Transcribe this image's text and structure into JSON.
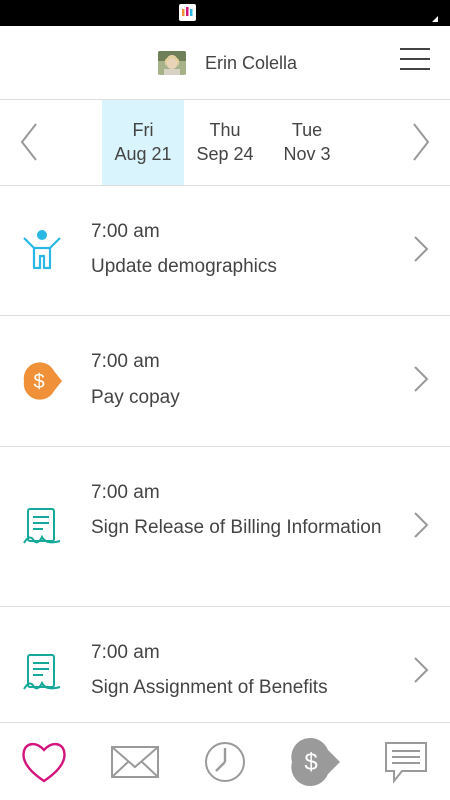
{
  "status_bar": {
    "app_icon": "app-logo-icon",
    "signal_icon": "signal-icon"
  },
  "header": {
    "user_name": "Erin Colella",
    "avatar_icon": "user-avatar",
    "menu_icon": "hamburger-menu-icon"
  },
  "date_nav": {
    "prev_icon": "chevron-left-icon",
    "next_icon": "chevron-right-icon",
    "dates": [
      {
        "dow": "Fri",
        "date": "Aug 21",
        "selected": true
      },
      {
        "dow": "Thu",
        "date": "Sep 24",
        "selected": false
      },
      {
        "dow": "Tue",
        "date": "Nov 3",
        "selected": false
      }
    ],
    "selected_color": "#d9f4fc"
  },
  "tasks": [
    {
      "time": "7:00 am",
      "title": "Update demographics",
      "icon": "person-icon"
    },
    {
      "time": "7:00 am",
      "title": "Pay copay",
      "icon": "dollar-tag-icon"
    },
    {
      "time": "7:00 am",
      "title": "Sign Release of Billing Information",
      "icon": "signature-document-icon"
    },
    {
      "time": "7:00 am",
      "title": "Sign Assignment of Benefits",
      "icon": "signature-document-icon"
    }
  ],
  "tabs": [
    {
      "icon": "heart-icon",
      "active": true
    },
    {
      "icon": "envelope-icon",
      "active": false
    },
    {
      "icon": "clock-icon",
      "active": false
    },
    {
      "icon": "dollar-tag-icon",
      "active": false
    },
    {
      "icon": "chat-bubble-icon",
      "active": false
    }
  ],
  "colors": {
    "accent_blue": "#29b8e5",
    "accent_orange": "#f0913a",
    "accent_teal": "#16a99a",
    "active_tab": "#d4147c",
    "inactive_tab": "#9a9a9a"
  }
}
